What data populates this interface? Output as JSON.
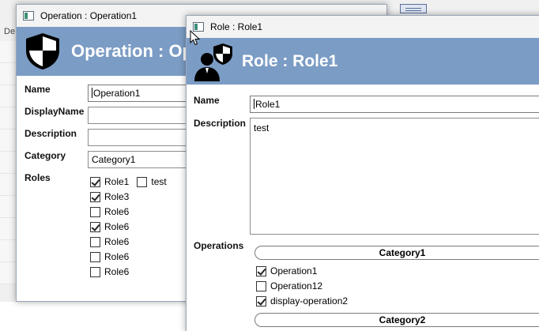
{
  "background": {
    "tab_label": "De"
  },
  "operation_window": {
    "title": "Operation : Operation1",
    "header_title": "Operation : Op",
    "fields": {
      "name_label": "Name",
      "name_value": "Operation1",
      "displayname_label": "DisplayName",
      "displayname_value": "",
      "description_label": "Description",
      "description_value": "",
      "category_label": "Category",
      "category_value": "Category1",
      "roles_label": "Roles"
    },
    "roles": [
      {
        "label": "Role1",
        "checked": true
      },
      {
        "label": "test",
        "checked": false
      },
      {
        "label": "Role3",
        "checked": true
      },
      {
        "label": "Role6",
        "checked": false
      },
      {
        "label": "Role6",
        "checked": true
      },
      {
        "label": "Role6",
        "checked": false
      },
      {
        "label": "Role6",
        "checked": false
      },
      {
        "label": "Role6",
        "checked": false
      }
    ]
  },
  "role_window": {
    "title": "Role : Role1",
    "header_title": "Role : Role1",
    "fields": {
      "name_label": "Name",
      "name_value": "Role1",
      "description_label": "Description",
      "description_value": "test",
      "operations_label": "Operations"
    },
    "categories": [
      {
        "label": "Category1",
        "operations": [
          {
            "label": "Operation1",
            "checked": true
          },
          {
            "label": "Operation12",
            "checked": false
          },
          {
            "label": "display-operation2",
            "checked": true
          }
        ]
      },
      {
        "label": "Category2",
        "operations": []
      }
    ]
  },
  "colors": {
    "header_bg": "#7b9cc4",
    "titlebar_bg": "#f3f3f3"
  },
  "icons": {
    "operation_header": "shield-icon",
    "role_header": "user-shield-icon",
    "window": "app-window-icon",
    "cursor": "mouse-pointer-icon"
  }
}
